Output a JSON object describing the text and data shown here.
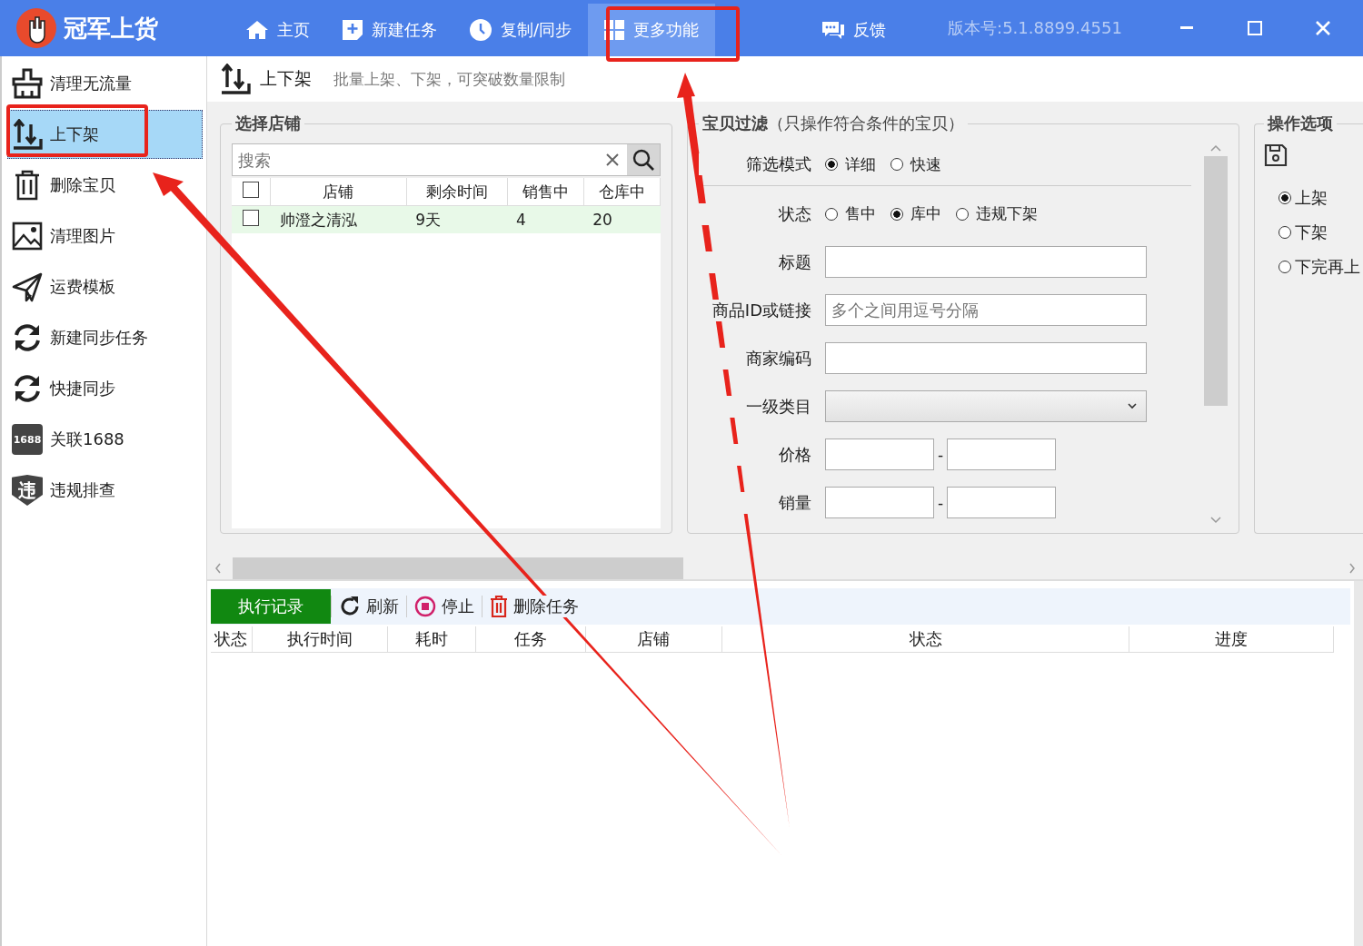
{
  "window": {
    "app_name": "冠军上货",
    "version": "版本号:5.1.8899.4551"
  },
  "nav": [
    {
      "label": "主页",
      "selected": false
    },
    {
      "label": "新建任务",
      "selected": false
    },
    {
      "label": "复制/同步",
      "selected": false
    },
    {
      "label": "更多功能",
      "selected": true
    },
    {
      "label": "反馈",
      "selected": false
    }
  ],
  "sidebar": {
    "items": [
      {
        "label": "清理无流量",
        "selected": false
      },
      {
        "label": "上下架",
        "selected": true
      },
      {
        "label": "删除宝贝",
        "selected": false
      },
      {
        "label": "清理图片",
        "selected": false
      },
      {
        "label": "运费模板",
        "selected": false
      },
      {
        "label": "新建同步任务",
        "selected": false
      },
      {
        "label": "快捷同步",
        "selected": false
      },
      {
        "label": "关联1688",
        "selected": false,
        "badge": "1688"
      },
      {
        "label": "违规排查",
        "selected": false,
        "badge": "违"
      }
    ]
  },
  "header": {
    "title": "上下架",
    "description": "批量上架、下架，可突破数量限制"
  },
  "store_panel": {
    "title": "选择店铺",
    "search": {
      "placeholder": "搜索"
    },
    "header_checked": false,
    "columns": [
      "店铺",
      "剩余时间",
      "销售中",
      "仓库中"
    ],
    "rows": [
      {
        "checked": false,
        "cells": [
          "帅澄之清泓",
          "9天",
          "4",
          "20"
        ]
      }
    ]
  },
  "filter_panel": {
    "title": "宝贝过滤",
    "subtitle": "（只操作符合条件的宝贝）",
    "mode": {
      "label": "筛选模式",
      "options": [
        {
          "label": "详细",
          "selected": true
        },
        {
          "label": "快速",
          "selected": false
        }
      ]
    },
    "status": {
      "label": "状态",
      "options": [
        {
          "label": "售中",
          "selected": false
        },
        {
          "label": "库中",
          "selected": true
        },
        {
          "label": "违规下架",
          "selected": false
        }
      ]
    },
    "fields": [
      {
        "kind": "text",
        "label": "标题"
      },
      {
        "kind": "text",
        "label": "商品ID或链接",
        "placeholder": "多个之间用逗号分隔"
      },
      {
        "kind": "text",
        "label": "商家编码"
      },
      {
        "kind": "select",
        "label": "一级类目"
      },
      {
        "kind": "range",
        "label": "价格",
        "separator": "-"
      },
      {
        "kind": "range",
        "label": "销量",
        "separator": "-"
      }
    ]
  },
  "options_panel": {
    "title": "操作选项",
    "options": [
      {
        "label": "上架",
        "selected": true
      },
      {
        "label": "下架",
        "selected": false
      },
      {
        "label": "下完再上",
        "selected": false
      }
    ]
  },
  "log": {
    "tab": {
      "label": "执行记录",
      "selected": true
    },
    "actions": [
      {
        "kind": "refresh",
        "label": "刷新"
      },
      {
        "kind": "stop",
        "label": "停止"
      },
      {
        "kind": "delete",
        "label": "删除任务"
      }
    ],
    "columns": [
      "状态",
      "执行时间",
      "耗时",
      "任务",
      "店铺",
      "状态",
      "进度"
    ]
  }
}
